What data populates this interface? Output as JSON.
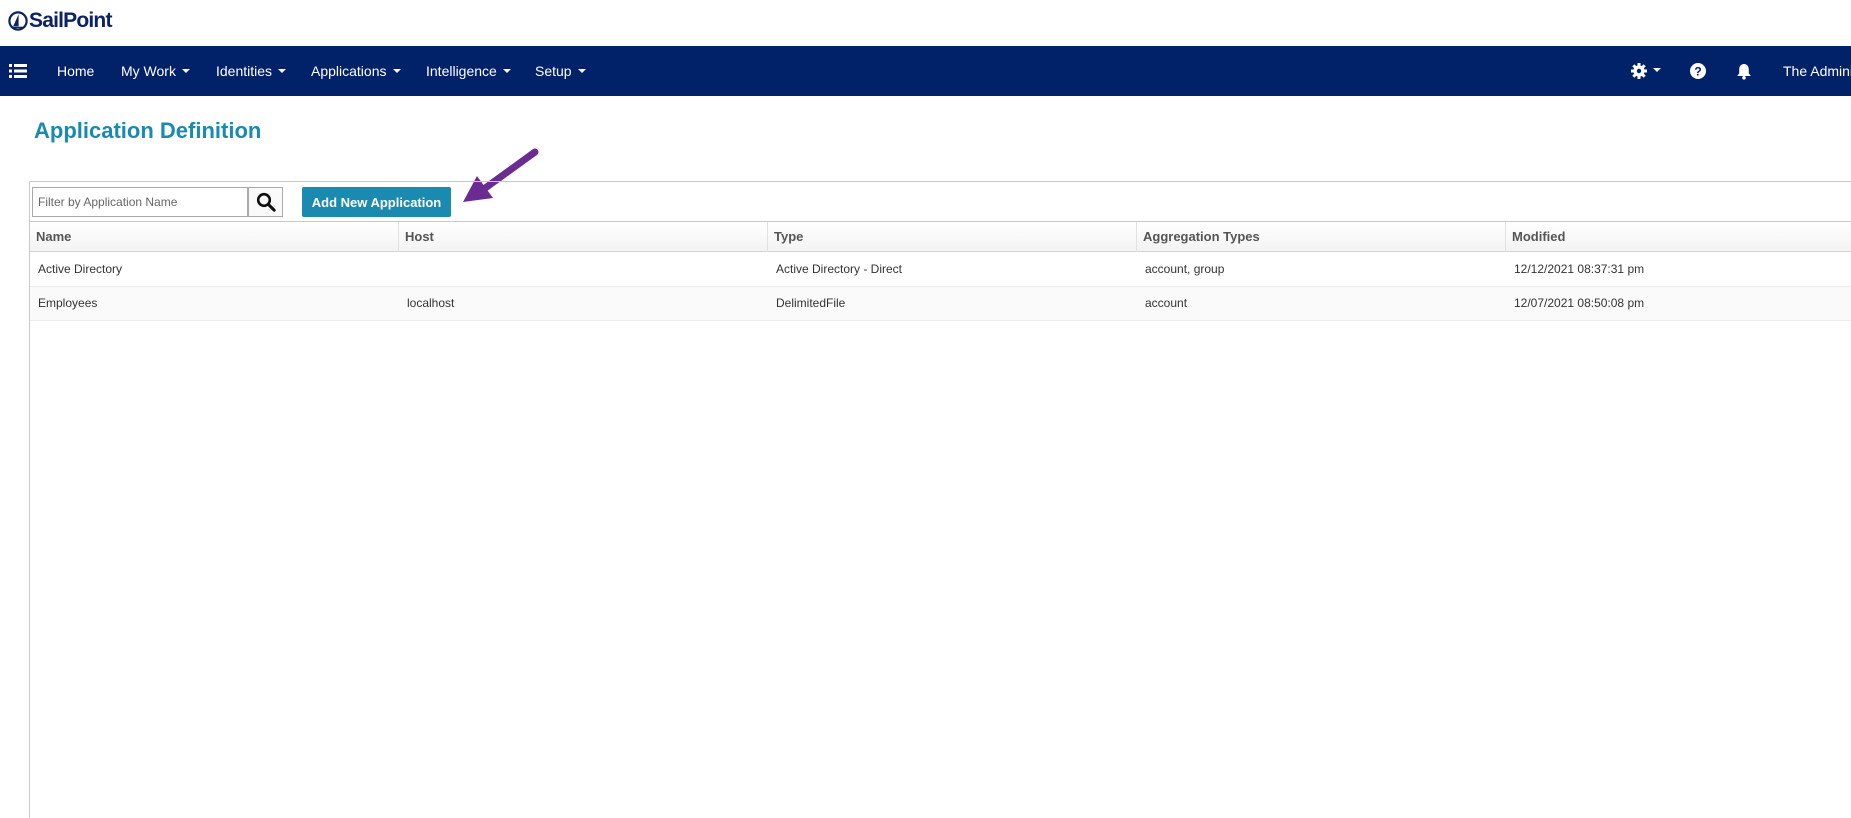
{
  "brand": {
    "name": "SailPoint",
    "color": "#0b2265"
  },
  "nav": {
    "menu_icon": "list-icon",
    "items": [
      {
        "label": "Home",
        "dropdown": false
      },
      {
        "label": "My Work",
        "dropdown": true
      },
      {
        "label": "Identities",
        "dropdown": true
      },
      {
        "label": "Applications",
        "dropdown": true
      },
      {
        "label": "Intelligence",
        "dropdown": true
      },
      {
        "label": "Setup",
        "dropdown": true
      }
    ],
    "right_icons": [
      "gear-icon",
      "help-icon",
      "bell-icon"
    ],
    "user_label": "The Adminis",
    "background": "#012169"
  },
  "page": {
    "title": "Application Definition",
    "title_color": "#1a8ab0"
  },
  "toolbar": {
    "filter_placeholder": "Filter by Application Name",
    "filter_value": "",
    "search_icon": "search-icon",
    "add_button_label": "Add New Application",
    "accent": "#1a8ab0"
  },
  "annotation": {
    "icon": "arrow-icon",
    "color": "#6b2c91"
  },
  "table": {
    "columns": [
      "Name",
      "Host",
      "Type",
      "Aggregation Types",
      "Modified"
    ],
    "rows": [
      [
        "Active Directory",
        "",
        "Active Directory - Direct",
        "account, group",
        "12/12/2021 08:37:31 pm"
      ],
      [
        "Employees",
        "localhost",
        "DelimitedFile",
        "account",
        "12/07/2021 08:50:08 pm"
      ]
    ]
  }
}
